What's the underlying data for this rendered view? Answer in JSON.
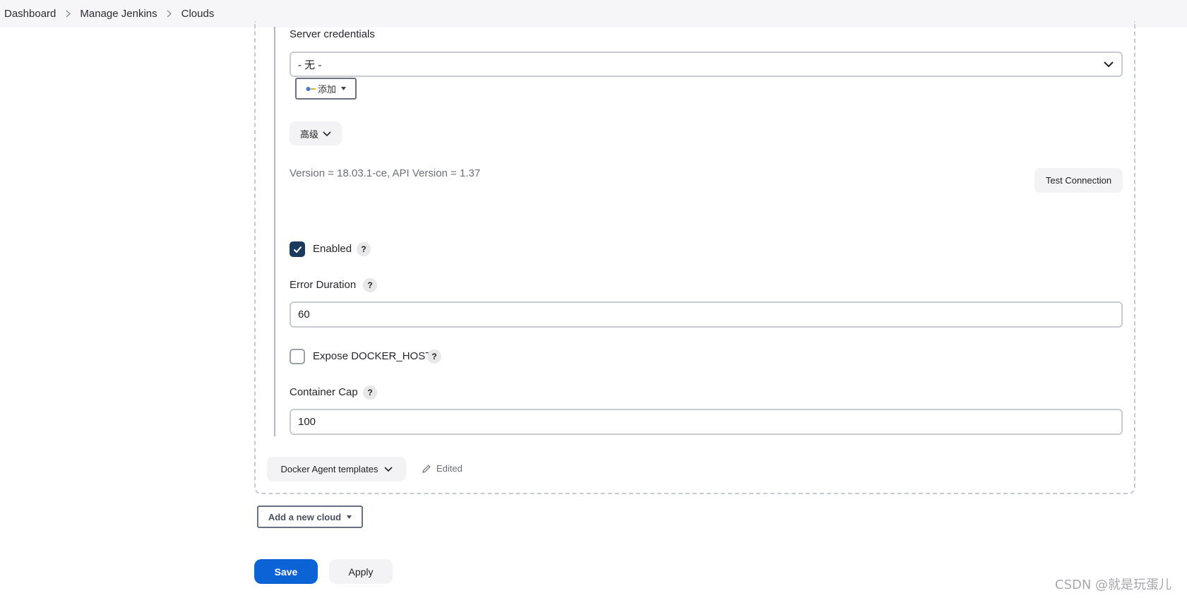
{
  "breadcrumb": [
    "Dashboard",
    "Manage Jenkins",
    "Clouds"
  ],
  "server_credentials": {
    "label": "Server credentials",
    "selected": "- 无 -",
    "add_label": "添加"
  },
  "advanced_label": "高级",
  "version_info": "Version = 18.03.1-ce, API Version = 1.37",
  "test_connection_label": "Test Connection",
  "enabled": {
    "label": "Enabled",
    "checked": true
  },
  "error_duration": {
    "label": "Error Duration",
    "value": "60"
  },
  "expose_docker_host": {
    "label": "Expose DOCKER_HOST",
    "checked": false
  },
  "container_cap": {
    "label": "Container Cap",
    "value": "100"
  },
  "help_glyph": "?",
  "docker_agent_templates_label": "Docker Agent templates",
  "edited_label": "Edited",
  "add_new_cloud_label": "Add a new cloud",
  "save_label": "Save",
  "apply_label": "Apply",
  "watermark": "CSDN @就是玩蛋儿",
  "colors": {
    "primary": "#0b63d6",
    "checkbox": "#1b3a5c"
  }
}
